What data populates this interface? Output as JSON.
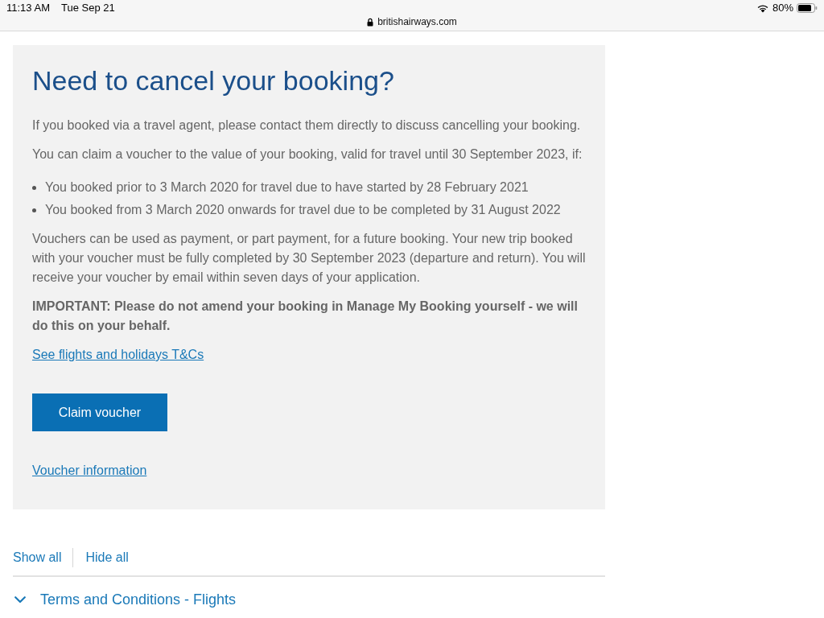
{
  "status_bar": {
    "time": "11:13 AM",
    "date": "Tue Sep 21",
    "url": "britishairways.com",
    "battery": "80%"
  },
  "card": {
    "title": "Need to cancel your booking?",
    "intro": [
      "If you booked via a travel agent, please contact them directly to discuss cancelling your booking.",
      "You can claim a voucher to the value of your booking, valid for travel until 30 September 2023, if:"
    ],
    "bullets": [
      "You booked prior to 3 March 2020 for travel due to have started by 28 February 2021",
      "You booked from 3 March 2020 onwards for travel due to be completed by 31 August 2022"
    ],
    "details": "Vouchers can be used as payment, or part payment, for a future booking. Your new trip booked with your voucher must be fully completed by 30 September 2023 (departure and return). You will receive your voucher by email within seven days of your application.",
    "notice": "IMPORTANT: Please do not amend your booking in Manage My Booking yourself - we will do this on your behalf.",
    "terms_link": "See flights and holidays T&Cs",
    "button": "Claim voucher",
    "info_link": "Voucher information"
  },
  "toggles": [
    "Show all",
    "Hide all"
  ],
  "accordion": [
    {
      "label": "Terms and Conditions - Flights",
      "expanded": false
    }
  ]
}
